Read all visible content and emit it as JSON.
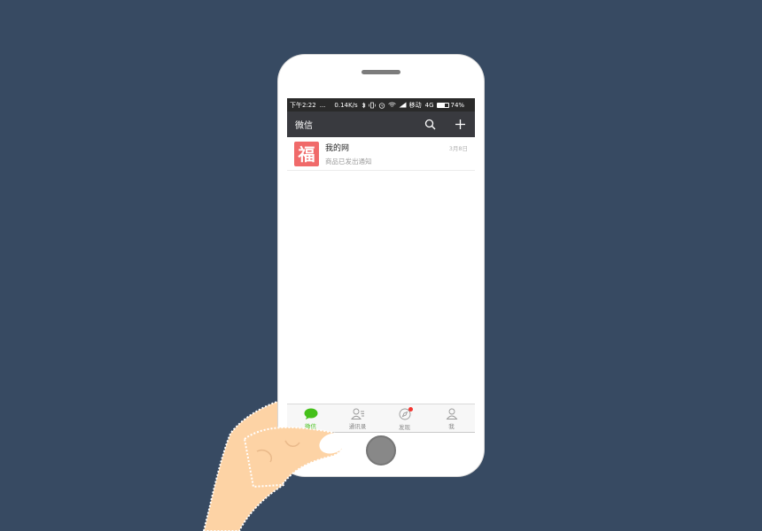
{
  "colors": {
    "background": "#374a62",
    "accent_green": "#45c01a",
    "titlebar": "#393a3f",
    "avatar": "#f06a6a",
    "badge_red": "#f43530"
  },
  "status_bar": {
    "time": "下午2:22",
    "dots": "...",
    "speed": "0.14K/s",
    "carrier": "移动",
    "network": "4G",
    "battery_percent": "74%",
    "battery_level": 0.74,
    "icons": [
      "bluetooth-icon",
      "vibrate-icon",
      "alarm-icon",
      "wifi-icon",
      "signal-icon",
      "battery-icon"
    ]
  },
  "titlebar": {
    "title": "微信",
    "search_icon": "search-icon",
    "add_icon": "plus-icon"
  },
  "chats": [
    {
      "avatar_char": "福",
      "name": "我的网",
      "message": "商品已发出通知",
      "time": "3月8日"
    }
  ],
  "tabs": [
    {
      "label": "微信",
      "icon": "chat-bubble-icon",
      "active": true
    },
    {
      "label": "通讯录",
      "icon": "contacts-icon",
      "active": false
    },
    {
      "label": "发现",
      "icon": "compass-icon",
      "active": false,
      "badge": true
    },
    {
      "label": "我",
      "icon": "person-icon",
      "active": false
    }
  ]
}
